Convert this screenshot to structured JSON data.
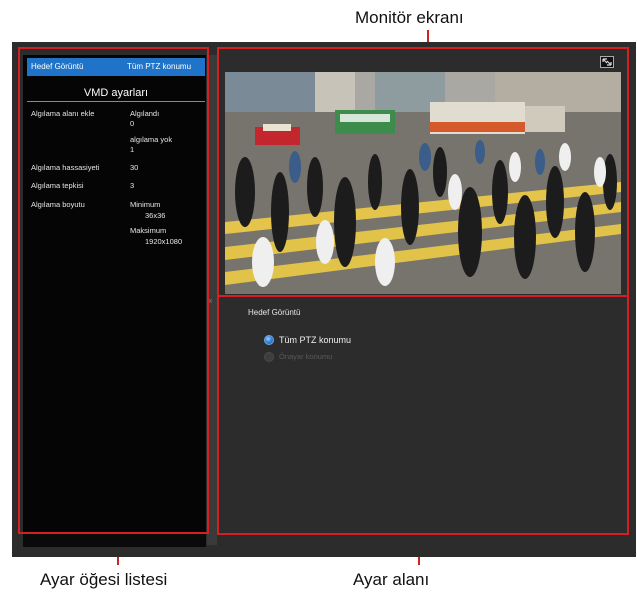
{
  "callouts": {
    "monitor": "Monitör ekranı",
    "item_list": "Ayar öğesi listesi",
    "settings_area": "Ayar alanı"
  },
  "sidebar": {
    "selected_item": {
      "label": "Hedef Görüntü",
      "value": "Tüm PTZ konumu"
    },
    "section_title": "VMD ayarları",
    "rows": [
      {
        "label": "Algılama alanı ekle",
        "values": [
          "Algılandı",
          "0",
          "algılama yok",
          "1"
        ]
      },
      {
        "label": "Algılama hassasiyeti",
        "value": "30"
      },
      {
        "label": "Algılama tepkisi",
        "value": "3"
      },
      {
        "label": "Algılama boyutu",
        "min_label": "Minimum",
        "min_value": "36x36",
        "max_label": "Maksimum",
        "max_value": "1920x1080"
      }
    ]
  },
  "monitor": {
    "expand_icon": "expand-icon"
  },
  "settings": {
    "heading": "Hedef Görüntü",
    "options": [
      {
        "label": "Tüm PTZ konumu",
        "selected": true,
        "enabled": true
      },
      {
        "label": "Önayar konumu",
        "selected": false,
        "enabled": false
      }
    ]
  },
  "colors": {
    "accent": "#1f73c8",
    "callout": "#d42020"
  }
}
